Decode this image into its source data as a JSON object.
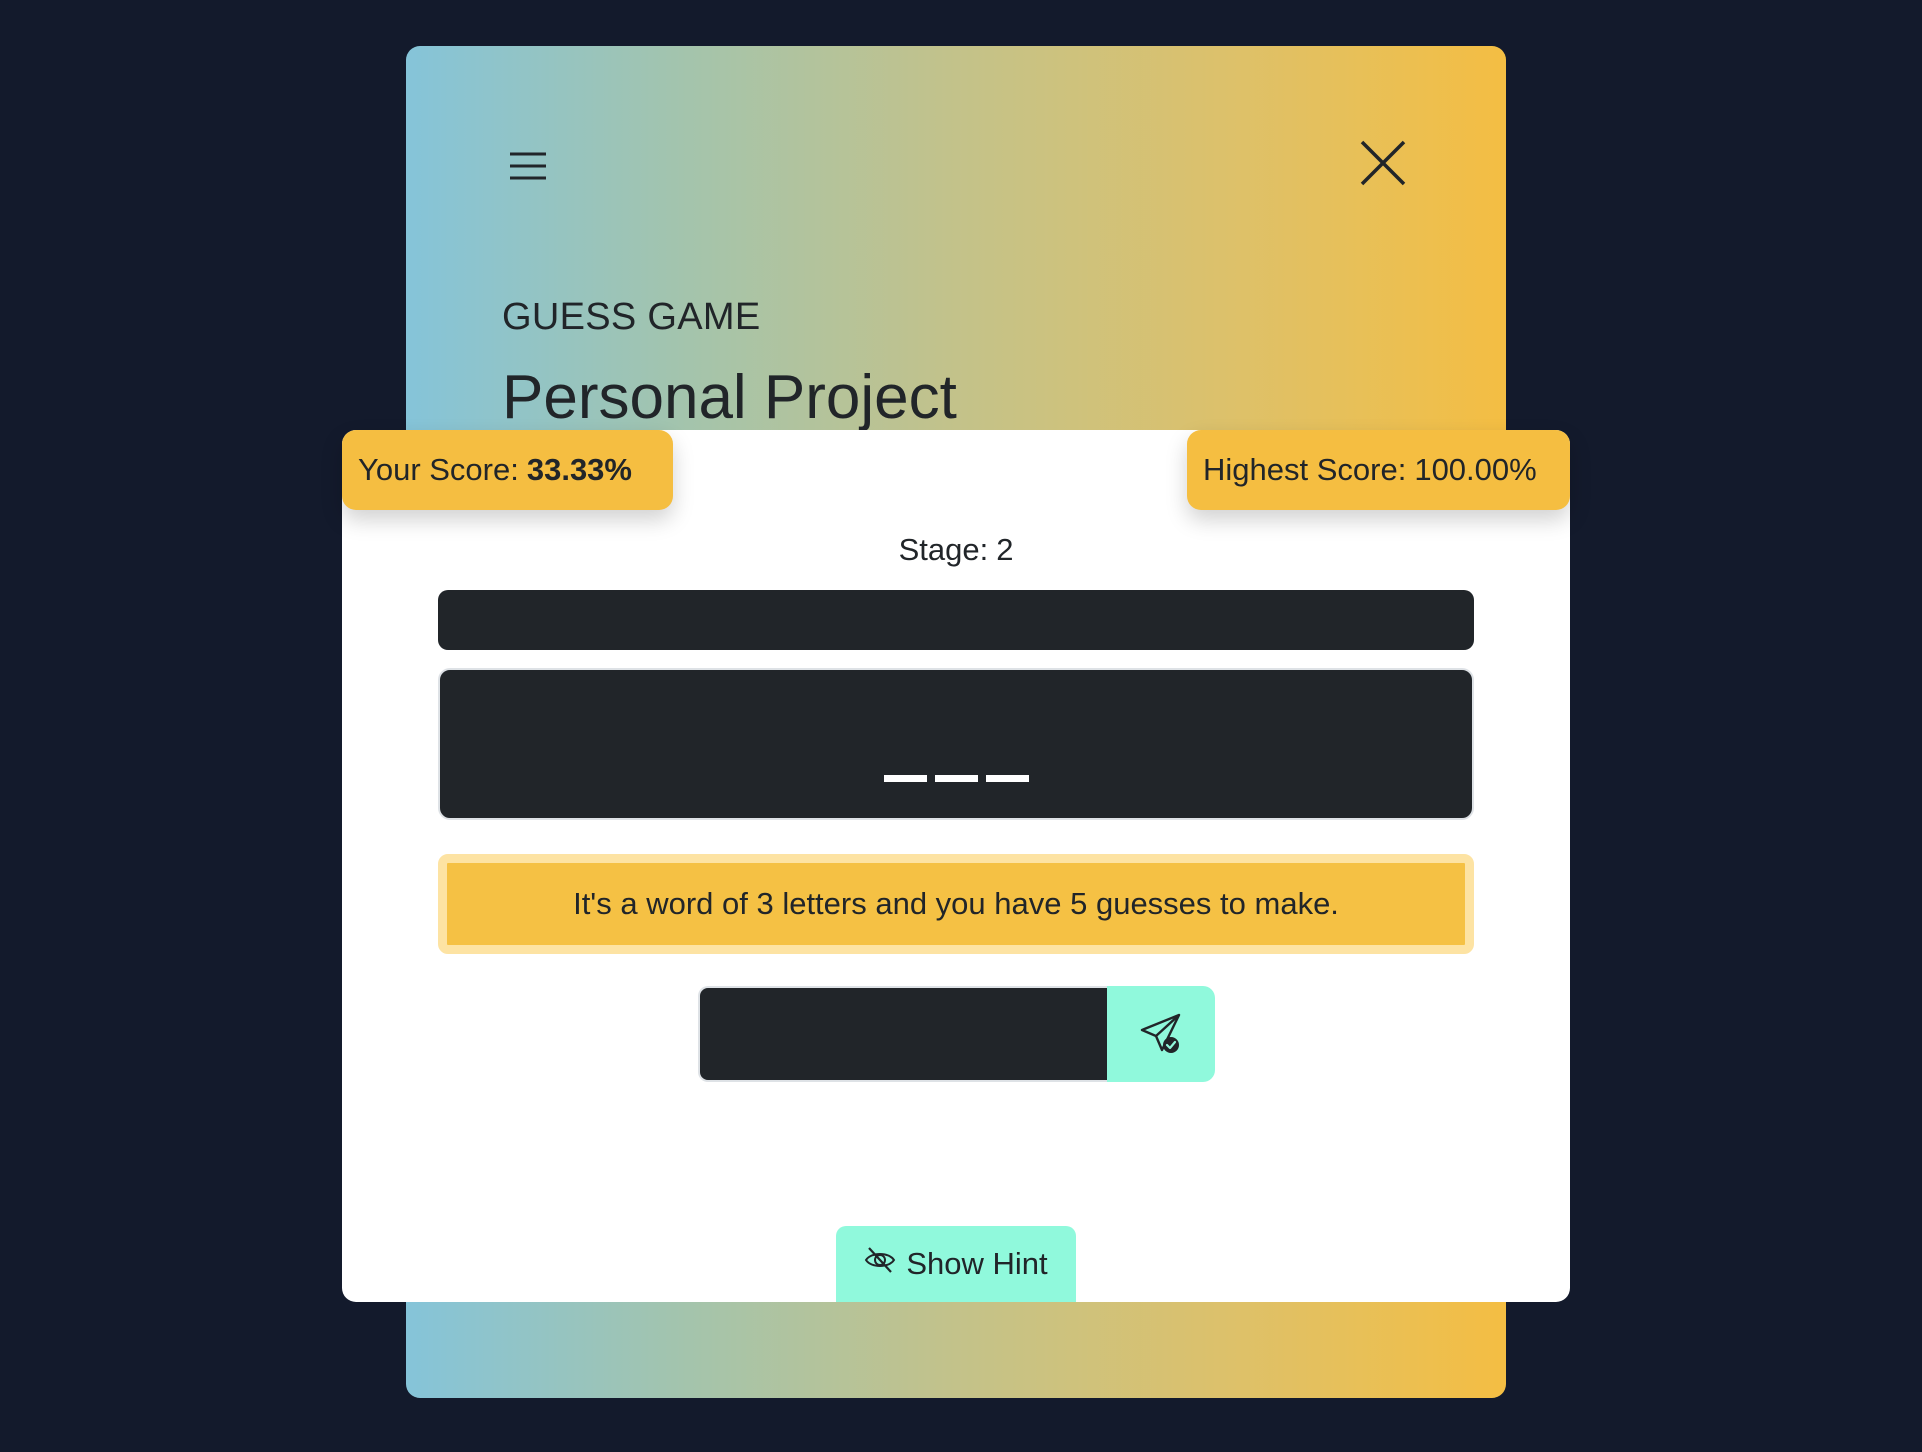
{
  "header": {
    "subtitle": "GUESS GAME",
    "title": "Personal Project",
    "menu_icon": "hamburger-menu-icon",
    "close_icon": "close-icon"
  },
  "score": {
    "your_label": "Your Score:",
    "your_value": "33.33%",
    "highest_label": "Highest Score:",
    "highest_value": "100.00%"
  },
  "game": {
    "stage_label": "Stage:",
    "stage_value": "2",
    "blanks": [
      "_",
      "_",
      "_"
    ],
    "info_message": "It's a word of 3 letters and you have 5 guesses to make.",
    "guess_input_value": "",
    "submit_icon": "send-check-icon",
    "hint_label": "Show Hint",
    "hint_icon": "eye-slash-icon"
  },
  "colors": {
    "background": "#131a2c",
    "gradient_start": "#85c4d9",
    "gradient_end": "#f4be43",
    "badge": "#f5be41",
    "dark": "#212529",
    "accent": "#90f9dc"
  }
}
